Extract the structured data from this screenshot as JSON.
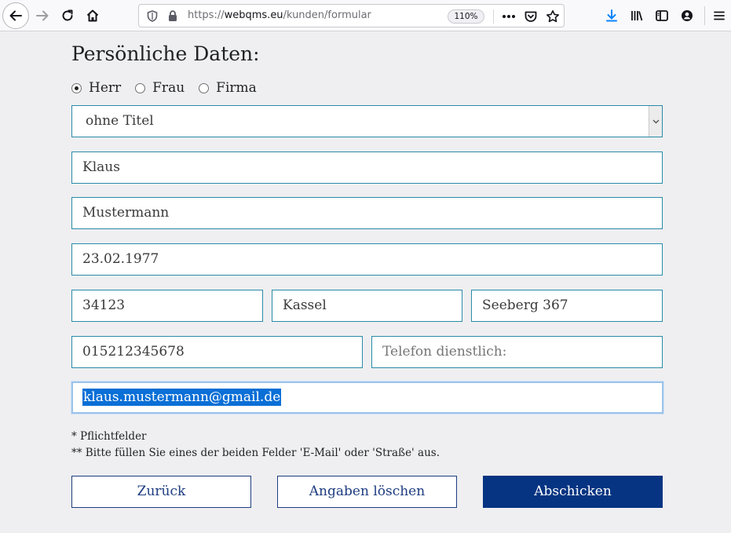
{
  "browser": {
    "url_prefix": "https://",
    "url_host": "webqms.eu",
    "url_path": "/kunden/formular",
    "zoom": "110%"
  },
  "form": {
    "heading": "Persönliche Daten:",
    "salutation": {
      "options": [
        "Herr",
        "Frau",
        "Firma"
      ],
      "selected": "Herr"
    },
    "title_select": {
      "value": "ohne Titel"
    },
    "first_name": {
      "value": "Klaus"
    },
    "last_name": {
      "value": "Mustermann"
    },
    "birth_date": {
      "value": "23.02.1977"
    },
    "postal_code": {
      "value": "34123"
    },
    "city": {
      "value": "Kassel"
    },
    "street": {
      "value": "Seeberg 367"
    },
    "phone_private": {
      "value": "015212345678"
    },
    "phone_business": {
      "placeholder": "Telefon dienstlich:"
    },
    "email": {
      "value": "klaus.mustermann@gmail.de"
    },
    "notes": {
      "required": "* Pflichtfelder",
      "either": "** Bitte füllen Sie eines der beiden Felder 'E-Mail' oder 'Straße' aus."
    },
    "buttons": {
      "back": "Zurück",
      "clear": "Angaben löschen",
      "submit": "Abschicken"
    }
  },
  "colors": {
    "field_border": "#2a8ba8",
    "primary_button": "#063482",
    "selection": "#0a6fd6"
  }
}
